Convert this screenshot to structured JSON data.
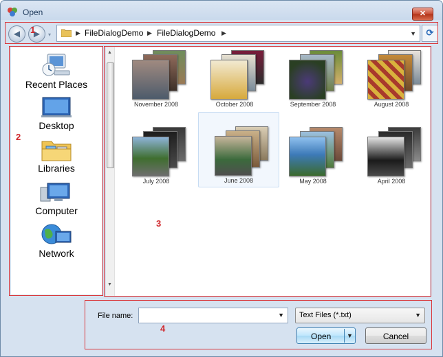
{
  "window": {
    "title": "Open",
    "close_glyph": "✕"
  },
  "navigation": {
    "back_glyph": "◀",
    "forward_glyph": "▶",
    "history_glyph": "▾",
    "breadcrumbs": [
      "FileDialogDemo",
      "FileDialogDemo"
    ],
    "crumb_separator": "▶",
    "address_dropdown_glyph": "▼",
    "refresh_glyph": "⟳"
  },
  "nav_pane": {
    "items": [
      {
        "label": "Recent Places",
        "icon": "recent-places-icon"
      },
      {
        "label": "Desktop",
        "icon": "desktop-icon"
      },
      {
        "label": "Libraries",
        "icon": "libraries-icon"
      },
      {
        "label": "Computer",
        "icon": "computer-icon"
      },
      {
        "label": "Network",
        "icon": "network-icon"
      }
    ]
  },
  "files": {
    "items": [
      {
        "label": "November 2008",
        "selected": false
      },
      {
        "label": "October 2008",
        "selected": false
      },
      {
        "label": "September 2008",
        "selected": false
      },
      {
        "label": "August 2008",
        "selected": false
      },
      {
        "label": "July 2008",
        "selected": false
      },
      {
        "label": "June 2008",
        "selected": true
      },
      {
        "label": "May 2008",
        "selected": false
      },
      {
        "label": "April 2008",
        "selected": false
      }
    ]
  },
  "bottom": {
    "file_name_label": "File name:",
    "file_name_value": "",
    "file_name_drop_glyph": "▼",
    "filter_value": "Text Files (*.txt)",
    "filter_drop_glyph": "▼",
    "open_label": "Open",
    "open_drop_glyph": "▼",
    "cancel_label": "Cancel"
  },
  "annotations": [
    "1",
    "2",
    "3",
    "4"
  ],
  "colors": {
    "annotation": "#d9363a",
    "selection": "#c7dcf3"
  }
}
